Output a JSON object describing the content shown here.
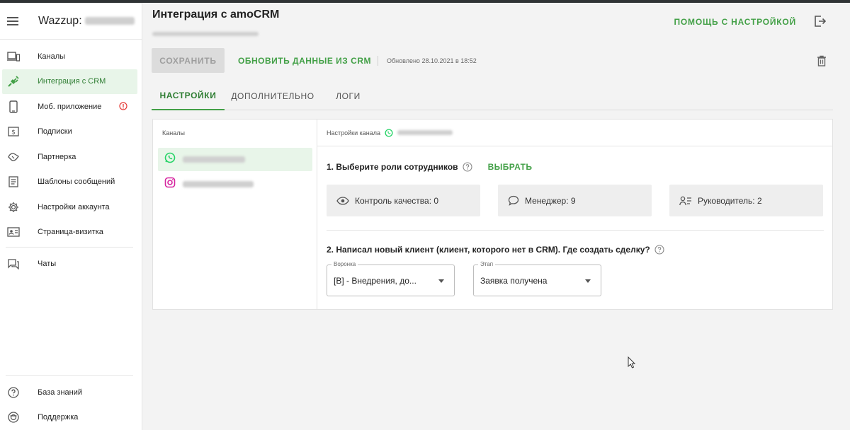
{
  "sidebar": {
    "brand": "Wazzup:",
    "items": [
      {
        "label": "Каналы",
        "icon": "devices-icon"
      },
      {
        "label": "Интеграция с CRM",
        "icon": "plug-icon"
      },
      {
        "label": "Моб. приложение",
        "icon": "phone-icon"
      },
      {
        "label": "Подписки",
        "icon": "dollar-icon"
      },
      {
        "label": "Партнерка",
        "icon": "partner-icon"
      },
      {
        "label": "Шаблоны сообщений",
        "icon": "template-icon"
      },
      {
        "label": "Настройки аккаунта",
        "icon": "gear-icon"
      },
      {
        "label": "Страница-визитка",
        "icon": "id-card-icon"
      },
      {
        "label": "Чаты",
        "icon": "chat-icon"
      }
    ],
    "bottom": [
      {
        "label": "База знаний",
        "icon": "help-icon"
      },
      {
        "label": "Поддержка",
        "icon": "support-icon"
      }
    ]
  },
  "header": {
    "title": "Интеграция с amoCRM",
    "help_label": "ПОМОЩЬ С НАСТРОЙКОЙ"
  },
  "toolbar": {
    "save_label": "СОХРАНИТЬ",
    "refresh_label": "ОБНОВИТЬ ДАННЫЕ ИЗ CRM",
    "updated_text": "Обновлено 28.10.2021 в 18:52"
  },
  "tabs": [
    {
      "label": "НАСТРОЙКИ",
      "active": true
    },
    {
      "label": "ДОПОЛНИТЕЛЬНО",
      "active": false
    },
    {
      "label": "ЛОГИ",
      "active": false
    }
  ],
  "channels": {
    "heading": "Каналы",
    "items": [
      {
        "type": "whatsapp",
        "active": true
      },
      {
        "type": "instagram",
        "active": false
      }
    ]
  },
  "settings": {
    "heading": "Настройки канала",
    "q1": "1. Выберите роли сотрудников",
    "choose_label": "ВЫБРАТЬ",
    "roles": [
      {
        "label": "Контроль качества: 0",
        "icon": "eye-icon"
      },
      {
        "label": "Менеджер: 9",
        "icon": "comment-icon"
      },
      {
        "label": "Руководитель: 2",
        "icon": "manager-icon"
      }
    ],
    "q2": "2. Написал новый клиент (клиент, которого нет в CRM). Где создать сделку?",
    "funnel": {
      "legend": "Воронка",
      "value": "[B] - Внедрения, до..."
    },
    "stage": {
      "legend": "Этап",
      "value": "Заявка получена"
    }
  },
  "colors": {
    "accent": "#43a047",
    "active_bg": "#e8f5e9"
  }
}
